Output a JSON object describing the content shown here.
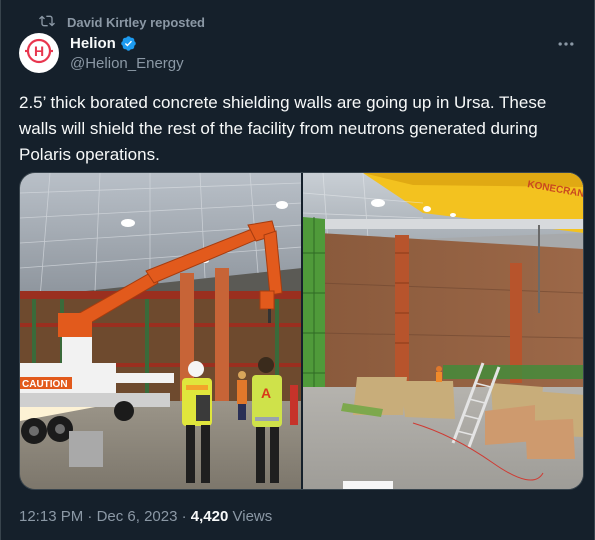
{
  "repost": {
    "label": "David Kirtley reposted",
    "icon": "repost-icon"
  },
  "author": {
    "name": "Helion",
    "handle": "@Helion_Energy",
    "verified_icon": "verified-badge-icon",
    "avatar_icon": "helion-logo-icon",
    "avatar_text": "H"
  },
  "post": {
    "text": "2.5’ thick borated concrete shielding walls are going up in Ursa. These walls will shield the rest of the facility from neutrons generated during Polaris operations."
  },
  "media": {
    "left_photo": {
      "sign_text": "CAUTION",
      "vest_letter": "A"
    },
    "right_photo": {
      "crane_text": "KONECRANES"
    }
  },
  "meta": {
    "time": "12:13 PM",
    "sep1": " · ",
    "date": "Dec 6, 2023",
    "sep2": " · ",
    "views_count": "4,420",
    "views_label": " Views"
  },
  "colors": {
    "background": "#15202b",
    "accent": "#1d9bf0",
    "secondary_text": "#8b98a5",
    "brand": "#e8364e"
  }
}
